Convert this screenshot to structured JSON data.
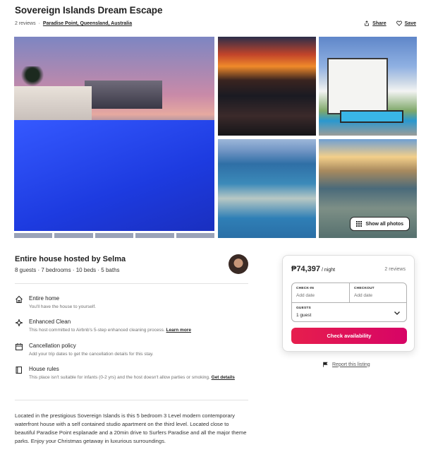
{
  "listing": {
    "title": "Sovereign Islands Dream Escape",
    "reviews": "2 reviews",
    "separator": "·",
    "location": "Paradise Point, Queensland, Australia"
  },
  "actions": {
    "share": "Share",
    "save": "Save"
  },
  "gallery": {
    "show_all": "Show all photos"
  },
  "host": {
    "title": "Entire house hosted by Selma",
    "summary": "8 guests · 7 bedrooms · 10 beds · 5 baths"
  },
  "features": [
    {
      "name": "Entire home",
      "desc": "You'll have the house to yourself.",
      "link": "",
      "icon": "home-icon"
    },
    {
      "name": "Enhanced Clean",
      "desc": "This host committed to Airbnb's 5-step enhanced cleaning process.",
      "link": "Learn more",
      "icon": "sparkle-icon"
    },
    {
      "name": "Cancellation policy",
      "desc": "Add your trip dates to get the cancellation details for this stay.",
      "link": "",
      "icon": "calendar-icon"
    },
    {
      "name": "House rules",
      "desc": "This place isn't suitable for infants (0-2 yrs) and the host doesn't allow parties or smoking.",
      "link": "Get details",
      "icon": "book-icon"
    }
  ],
  "description": "Located in the prestigious Sovereign Islands is this 5 bedroom 3 Level modern contemporary waterfront house with a self contained studio apartment on the third level. Located close to beautiful Paradise Point esplanade and a 20min drive to Surfers Paradise and all the major theme parks. Enjoy your Christmas getaway in luxurious surroundings.",
  "booking": {
    "price": "₱74,397",
    "per_night": "/ night",
    "reviews": "2 reviews",
    "checkin_label": "CHECK-IN",
    "checkin_placeholder": "Add date",
    "checkout_label": "CHECKOUT",
    "checkout_placeholder": "Add date",
    "guests_label": "GUESTS",
    "guests_value": "1 guest",
    "cta": "Check availability"
  },
  "report": {
    "label": "Report this listing"
  },
  "colors": {
    "accent": "#E61E4D",
    "text": "#222222",
    "muted": "#717171",
    "border": "#DDDDDD"
  }
}
